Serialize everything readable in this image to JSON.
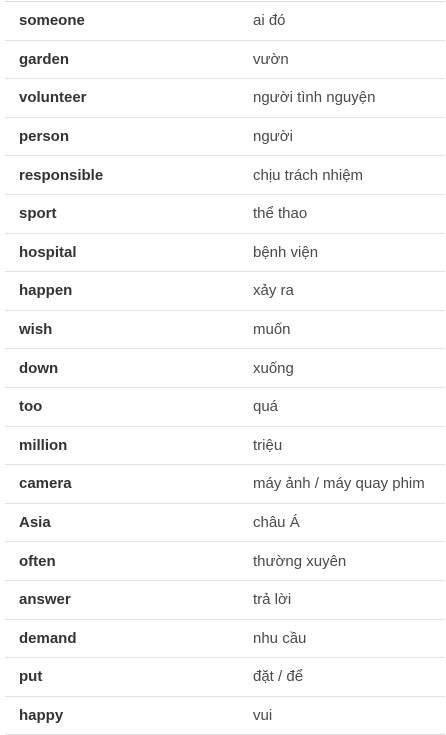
{
  "rows": [
    {
      "word": "someone",
      "meaning": "ai đó"
    },
    {
      "word": "garden",
      "meaning": "vườn"
    },
    {
      "word": "volunteer",
      "meaning": "người tình nguyện"
    },
    {
      "word": "person",
      "meaning": "người"
    },
    {
      "word": "responsible",
      "meaning": "chịu trách nhiệm"
    },
    {
      "word": "sport",
      "meaning": "thể thao"
    },
    {
      "word": "hospital",
      "meaning": "bệnh viện"
    },
    {
      "word": "happen",
      "meaning": "xảy ra"
    },
    {
      "word": "wish",
      "meaning": "muốn"
    },
    {
      "word": "down",
      "meaning": "xuống"
    },
    {
      "word": "too",
      "meaning": "quá"
    },
    {
      "word": "million",
      "meaning": "triệu"
    },
    {
      "word": "camera",
      "meaning": "máy ảnh / máy quay phim"
    },
    {
      "word": "Asia",
      "meaning": "châu Á"
    },
    {
      "word": "often",
      "meaning": "thường xuyên"
    },
    {
      "word": "answer",
      "meaning": "trả lời"
    },
    {
      "word": "demand",
      "meaning": "nhu cầu"
    },
    {
      "word": "put",
      "meaning": "đặt / để"
    },
    {
      "word": "happy",
      "meaning": "vui"
    }
  ]
}
